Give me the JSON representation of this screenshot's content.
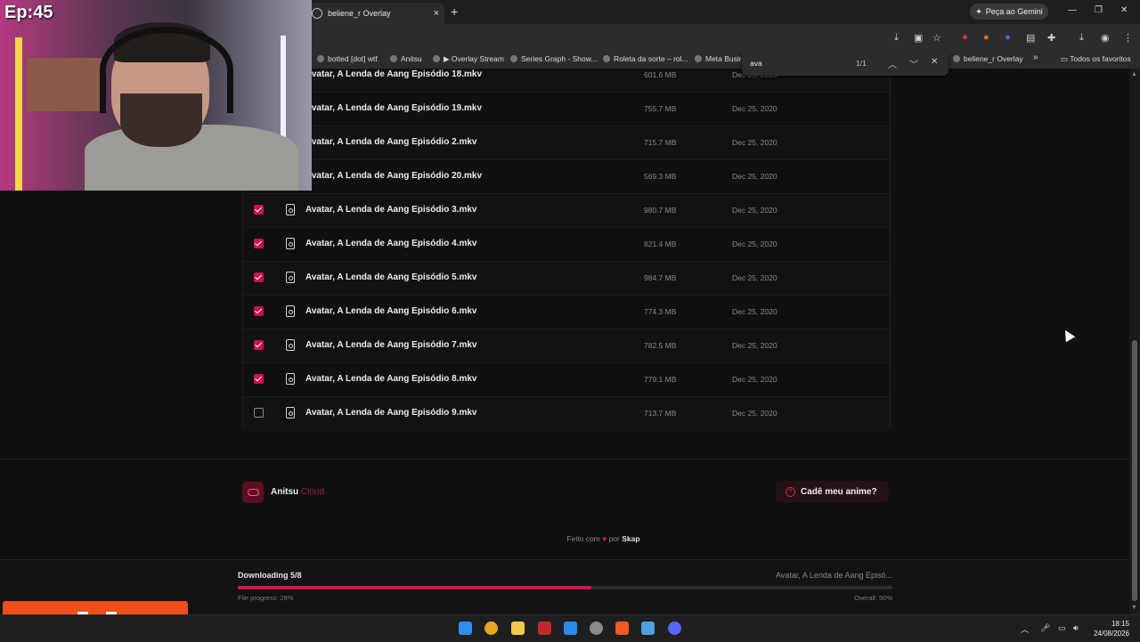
{
  "browser": {
    "tab_title": "beliene_r Overlay",
    "new_tab": "+",
    "gemini_label": "Peça ao Gemini",
    "bookmarks": [
      "botted [dot] wtf",
      "Anitsu",
      "▶ Overlay Stream",
      "Series Graph - Show...",
      "Roleta da sorte – rol...",
      "Meta Busir",
      "beliene_r Overlay",
      "Todos os favoritos"
    ],
    "bookmark_more": "»"
  },
  "find_bar": {
    "query": "ava",
    "count": "1/1"
  },
  "files": [
    {
      "name": "Avatar, A Lenda de Aang Episódio 18.mkv",
      "size": "601.6 MB",
      "date": "Dec 25, 2020",
      "checked": true
    },
    {
      "name": "Avatar, A Lenda de Aang Episódio 19.mkv",
      "size": "755.7 MB",
      "date": "Dec 25, 2020",
      "checked": true
    },
    {
      "name": "Avatar, A Lenda de Aang Episódio 2.mkv",
      "size": "715.7 MB",
      "date": "Dec 25, 2020",
      "checked": true
    },
    {
      "name": "Avatar, A Lenda de Aang Episódio 20.mkv",
      "size": "569.3 MB",
      "date": "Dec 25, 2020",
      "checked": true
    },
    {
      "name": "Avatar, A Lenda de Aang Episódio 3.mkv",
      "size": "980.7 MB",
      "date": "Dec 25, 2020",
      "checked": true
    },
    {
      "name": "Avatar, A Lenda de Aang Episódio 4.mkv",
      "size": "821.4 MB",
      "date": "Dec 25, 2020",
      "checked": true
    },
    {
      "name": "Avatar, A Lenda de Aang Episódio 5.mkv",
      "size": "984.7 MB",
      "date": "Dec 25, 2020",
      "checked": true
    },
    {
      "name": "Avatar, A Lenda de Aang Episódio 6.mkv",
      "size": "774.3 MB",
      "date": "Dec 25, 2020",
      "checked": true
    },
    {
      "name": "Avatar, A Lenda de Aang Episódio 7.mkv",
      "size": "782.5 MB",
      "date": "Dec 25, 2020",
      "checked": true
    },
    {
      "name": "Avatar, A Lenda de Aang Episódio 8.mkv",
      "size": "779.1 MB",
      "date": "Dec 25, 2020",
      "checked": true
    },
    {
      "name": "Avatar, A Lenda de Aang Episódio 9.mkv",
      "size": "713.7 MB",
      "date": "Dec 25, 2020",
      "checked": false
    }
  ],
  "footer": {
    "brand_name": "Anitsu",
    "brand_suffix": "Cloud",
    "help_button": "Cadê meu anime?",
    "made_with_prefix": "Feito com",
    "heart": "♥",
    "made_with_by": "por",
    "made_with_author": "Skap"
  },
  "download": {
    "title": "Downloading 5/8",
    "current_file": "Avatar, A Lenda de Aang Episó...",
    "progress": 0.54,
    "file_progress": "File progress: 28%",
    "overall": "Overall: 50%"
  },
  "overlay": {
    "episode_label": "Ep:45"
  },
  "taskbar": {
    "time": "18:15",
    "date": "24/08/2026"
  },
  "colors": {
    "accent": "#d0184f",
    "background": "#101011",
    "checkbox": "#c8144a"
  }
}
